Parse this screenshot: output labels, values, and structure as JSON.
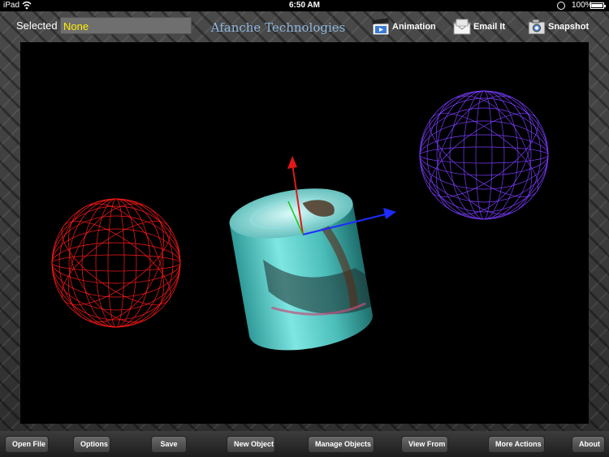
{
  "status_bar": {
    "carrier": "iPad",
    "time": "6:50 AM",
    "battery_percent": "100%",
    "icons": [
      "wifi-icon",
      "orientation-lock-icon",
      "battery-icon"
    ]
  },
  "toolbar": {
    "selected_label": "Selected",
    "selected_value": "None",
    "brand": "Afanche Technologies",
    "animation_label": "Animation",
    "email_label": "Email It",
    "snapshot_label": "Snapshot",
    "icons": [
      "clapperboard-icon",
      "envelope-icon",
      "camera-icon"
    ]
  },
  "scene": {
    "background": "#000000",
    "objects": [
      {
        "name": "red-wireframe-sphere",
        "color": "#ff1a1a"
      },
      {
        "name": "textured-cylinder",
        "color": "#5fd3d0"
      },
      {
        "name": "purple-wireframe-sphere",
        "color": "#7a3cff"
      }
    ],
    "axes_colors": {
      "x": "#1e2cff",
      "y": "#e01818",
      "z": "#18c818"
    }
  },
  "bottom_bar": {
    "buttons": [
      "Open File",
      "Options",
      "Save",
      "New Object",
      "Manage Objects",
      "View From",
      "More Actions",
      "About"
    ]
  }
}
